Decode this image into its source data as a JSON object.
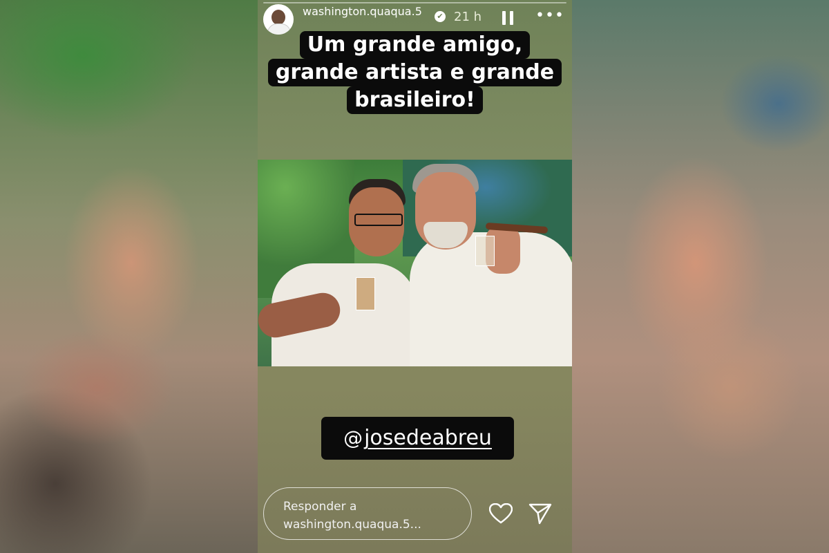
{
  "story": {
    "username": "washington.quaqua.5",
    "time": "21 h",
    "verified_glyph": "✔",
    "more_glyph": "•••",
    "caption_lines": [
      "Um grande amigo,",
      "grande artista e grande",
      "brasileiro!"
    ],
    "mention": {
      "at_glyph": "@",
      "handle": "josedeabreu"
    },
    "reply_placeholder": "Responder a washington.quaqua.5..."
  },
  "icons": {
    "avatar": "profile-avatar",
    "verified": "verified-badge-icon",
    "pause": "pause-icon",
    "more": "more-options-icon",
    "heart": "heart-icon",
    "send": "send-icon",
    "threads": "threads-icon"
  },
  "colors": {
    "caption_bg": "#0b0b0b",
    "caption_text": "#ffffff",
    "story_bg_top": "#6f8258",
    "story_bg_bottom": "#7c7a5a"
  }
}
